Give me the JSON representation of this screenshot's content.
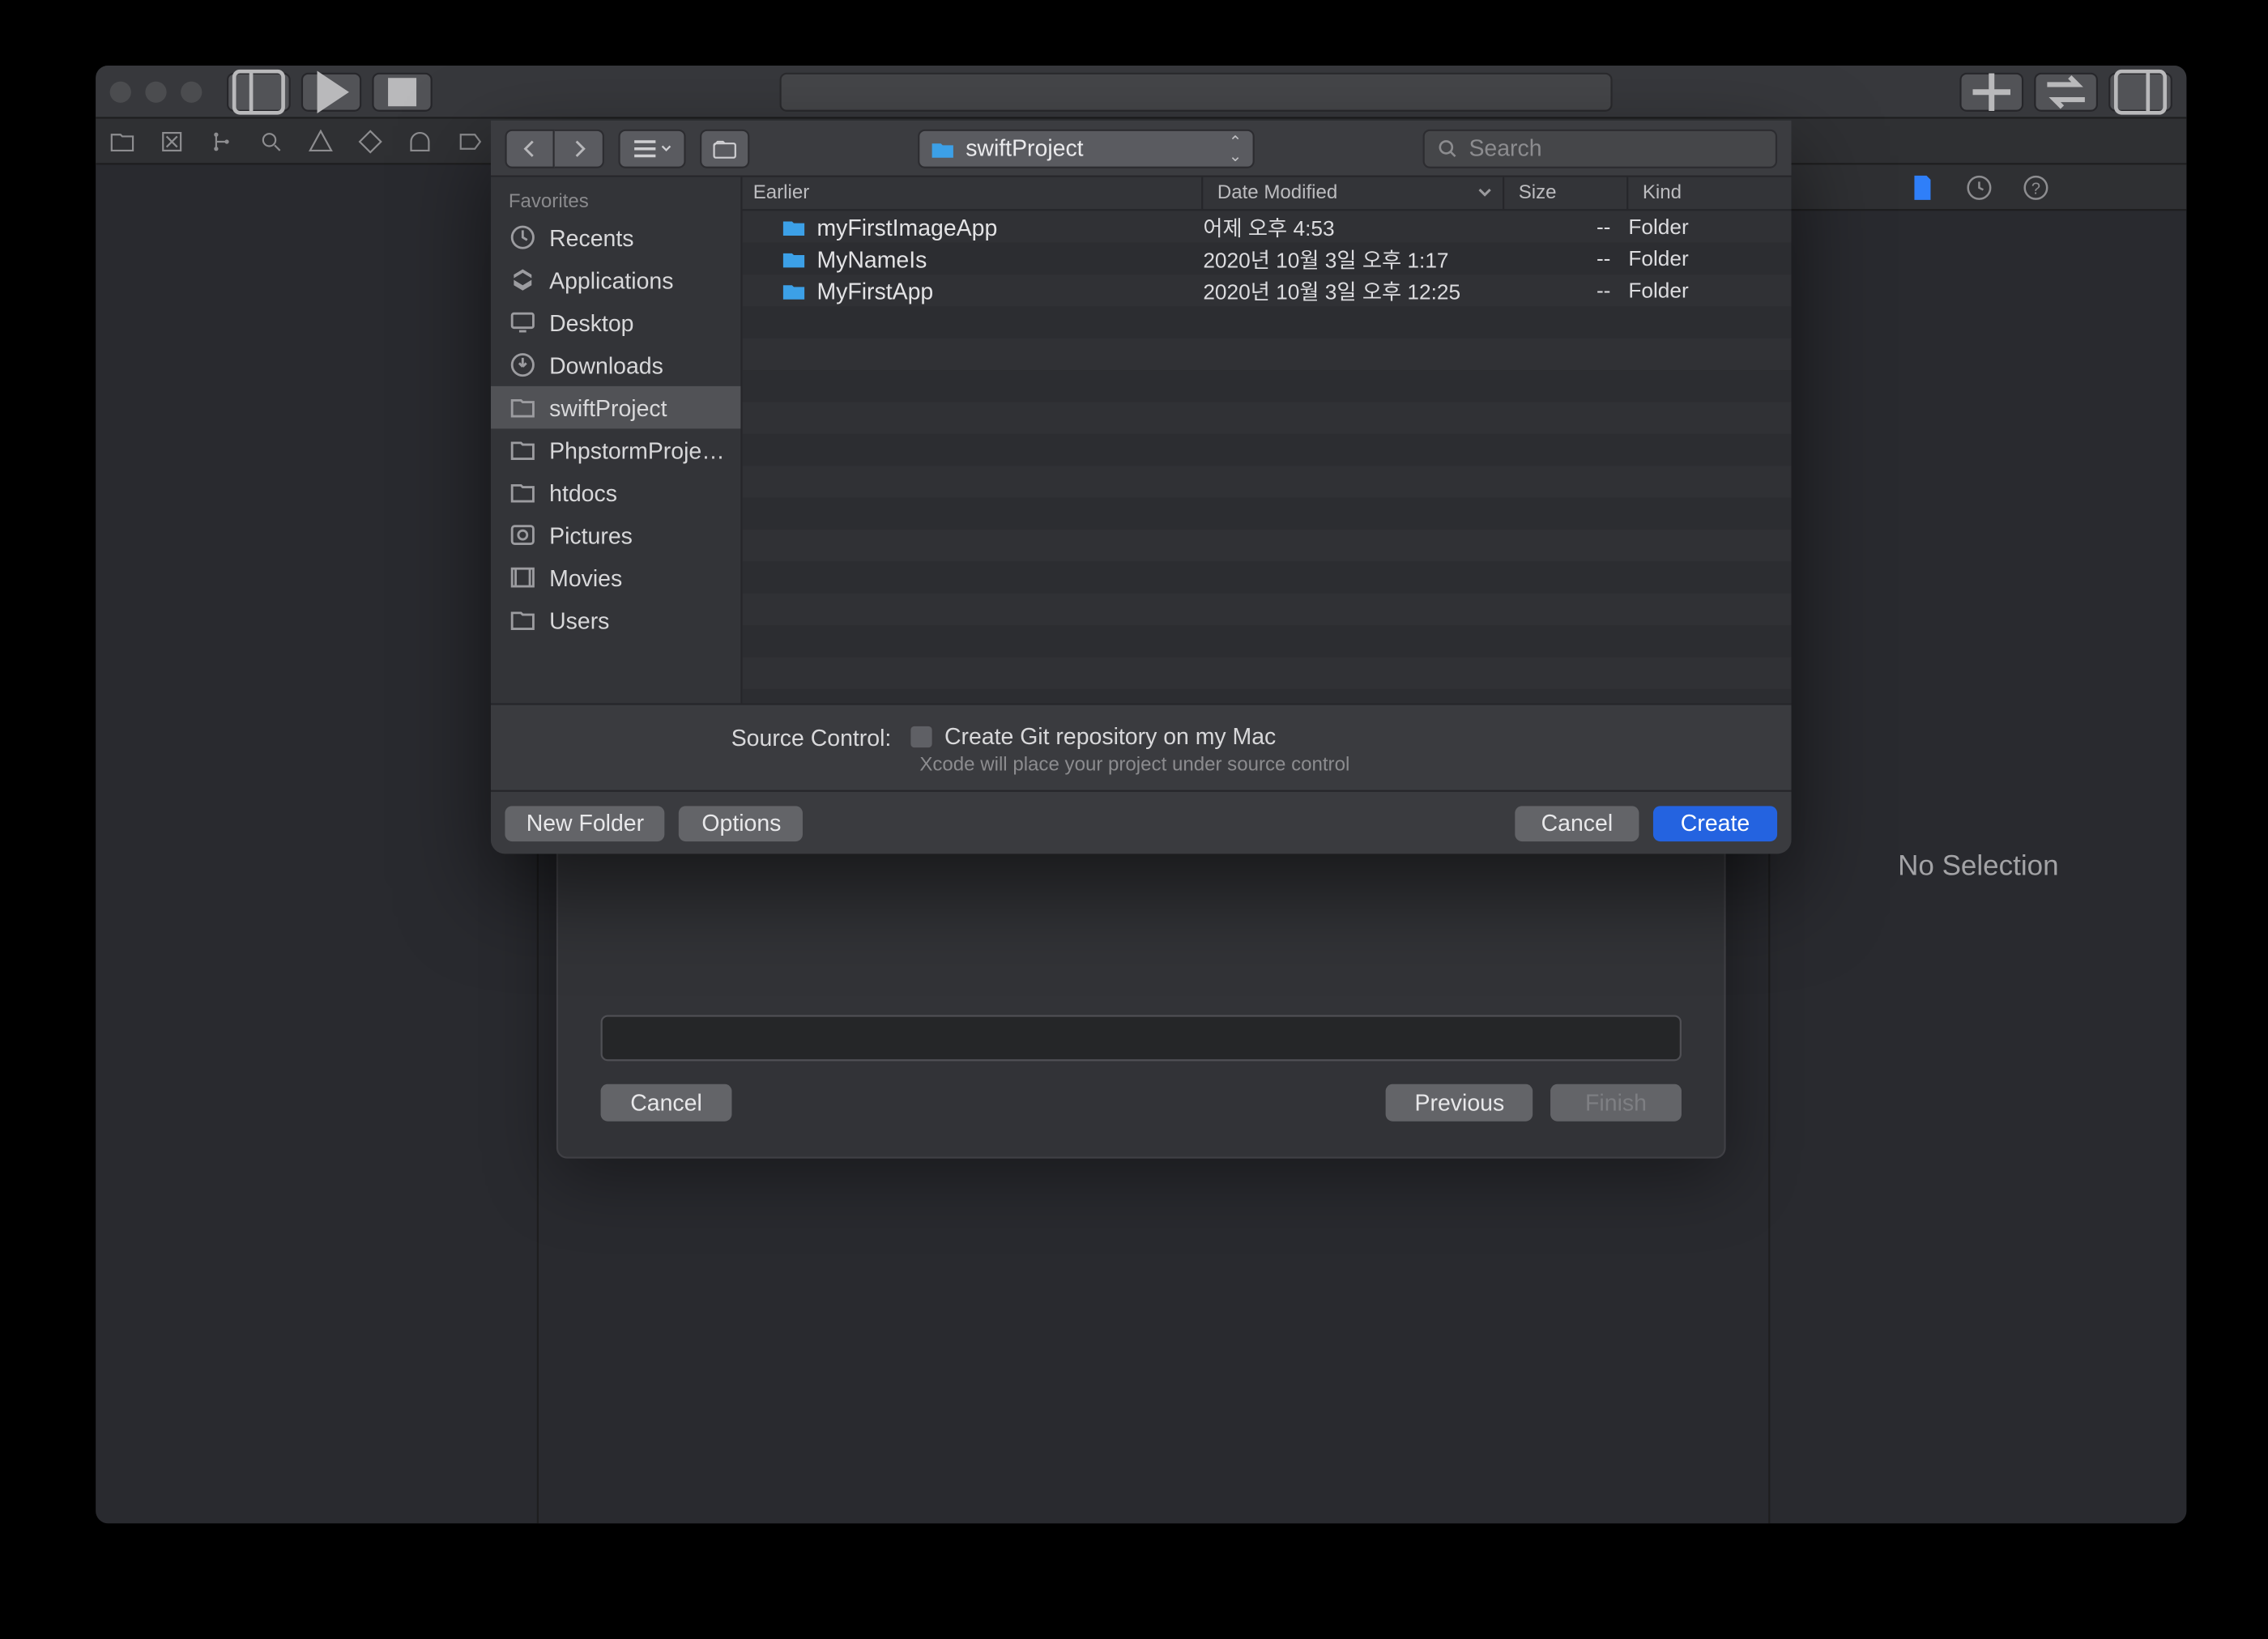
{
  "toolbar": {},
  "right_panel": {
    "no_selection": "No Selection"
  },
  "wizard": {
    "cancel": "Cancel",
    "previous": "Previous",
    "finish": "Finish"
  },
  "save_panel": {
    "location": "swiftProject",
    "search_placeholder": "Search",
    "sidebar": {
      "favorites_header": "Favorites",
      "items": [
        {
          "label": "Recents",
          "icon": "clock"
        },
        {
          "label": "Applications",
          "icon": "apps"
        },
        {
          "label": "Desktop",
          "icon": "desktop"
        },
        {
          "label": "Downloads",
          "icon": "downloads"
        },
        {
          "label": "swiftProject",
          "icon": "folder",
          "selected": true
        },
        {
          "label": "PhpstormProje…",
          "icon": "folder"
        },
        {
          "label": "htdocs",
          "icon": "folder"
        },
        {
          "label": "Pictures",
          "icon": "pictures"
        },
        {
          "label": "Movies",
          "icon": "movies"
        },
        {
          "label": "Users",
          "icon": "folder"
        }
      ]
    },
    "columns": {
      "name_group": "Earlier",
      "date": "Date Modified",
      "size": "Size",
      "kind": "Kind"
    },
    "rows": [
      {
        "name": "myFirstImageApp",
        "date": "어제 오후 4:53",
        "size": "--",
        "kind": "Folder"
      },
      {
        "name": "MyNameIs",
        "date": "2020년 10월 3일 오후 1:17",
        "size": "--",
        "kind": "Folder"
      },
      {
        "name": "MyFirstApp",
        "date": "2020년 10월 3일 오후 12:25",
        "size": "--",
        "kind": "Folder"
      }
    ],
    "source_control": {
      "label": "Source Control:",
      "checkbox": "Create Git repository on my Mac",
      "hint": "Xcode will place your project under source control"
    },
    "buttons": {
      "new_folder": "New Folder",
      "options": "Options",
      "cancel": "Cancel",
      "create": "Create"
    }
  }
}
